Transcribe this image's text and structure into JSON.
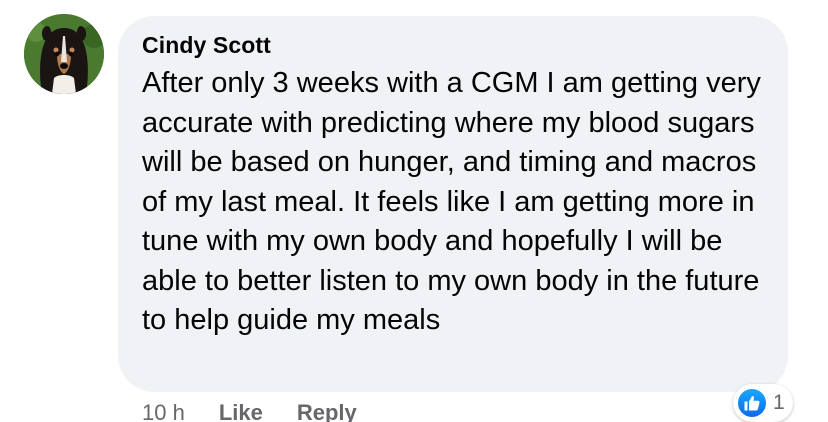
{
  "comment": {
    "author": "Cindy Scott",
    "text": "After only 3 weeks with a CGM I am getting very accurate with predicting where my blood sugars will be based on hunger, and timing and macros of my last meal. It feels like I am getting more in tune with my own body and hopefully I will be able to better listen to my own body in the future to help guide my meals",
    "avatar_icon": "dog-avatar",
    "time": "10 h",
    "like_label": "Like",
    "reply_label": "Reply",
    "reactions": {
      "icon": "thumbs-up-icon",
      "count": "1",
      "color": "#1877f2"
    }
  }
}
